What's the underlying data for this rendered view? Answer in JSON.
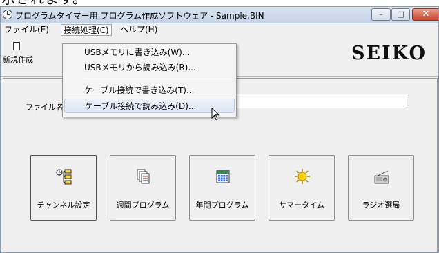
{
  "caption_fragment": "示されます。",
  "window": {
    "title": "プログラムタイマー用 プログラム作成ソフトウェア - Sample.BIN",
    "controls": {
      "minimize": "–",
      "maximize": "□",
      "close": "✕"
    }
  },
  "menubar": [
    "ファイル(E)",
    "接続処理(C)",
    "ヘルプ(H)"
  ],
  "toolbar": {
    "new_label": "新規作成",
    "brand": "SEIKO"
  },
  "file": {
    "label": "ファイル名",
    "value": ""
  },
  "buttons": [
    {
      "label": "チャンネル設定",
      "icon": "channel-tree-icon"
    },
    {
      "label": "週間プログラム",
      "icon": "weekly-pages-icon"
    },
    {
      "label": "年間プログラム",
      "icon": "calendar-icon"
    },
    {
      "label": "サマータイム",
      "icon": "sun-icon"
    },
    {
      "label": "ラジオ選局",
      "icon": "radio-icon"
    }
  ],
  "dropdown": [
    "USBメモリに書き込み(W)...",
    "USBメモリから読み込み(R)...",
    "ケーブル接続で書き込み(T)...",
    "ケーブル接続で読み込み(D)..."
  ],
  "colors": {
    "titlebar": "#c4d3e6",
    "close_button": "#c5432a",
    "highlight": "#dce7f5"
  }
}
